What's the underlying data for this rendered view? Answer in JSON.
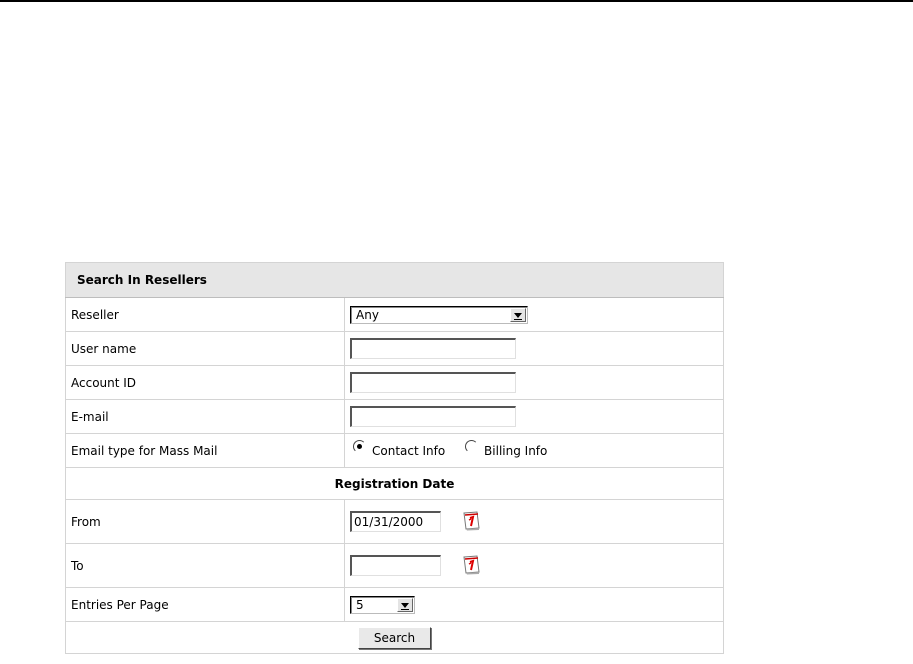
{
  "panel": {
    "title": "Search In Resellers",
    "reseller": {
      "label": "Reseller",
      "selected": "Any"
    },
    "username": {
      "label": "User name",
      "value": ""
    },
    "account_id": {
      "label": "Account ID",
      "value": ""
    },
    "email": {
      "label": "E-mail",
      "value": ""
    },
    "email_type": {
      "label": "Email type for Mass Mail",
      "options": [
        {
          "label": "Contact Info",
          "selected": true
        },
        {
          "label": "Billing Info",
          "selected": false
        }
      ]
    },
    "registration_section": "Registration Date",
    "from": {
      "label": "From",
      "value": "01/31/2000"
    },
    "to": {
      "label": "To",
      "value": ""
    },
    "entries_per_page": {
      "label": "Entries Per Page",
      "selected": "5"
    },
    "search_button": "Search"
  },
  "icons": {
    "calendar": "calendar-icon",
    "dropdown": "chevron-down-icon"
  }
}
